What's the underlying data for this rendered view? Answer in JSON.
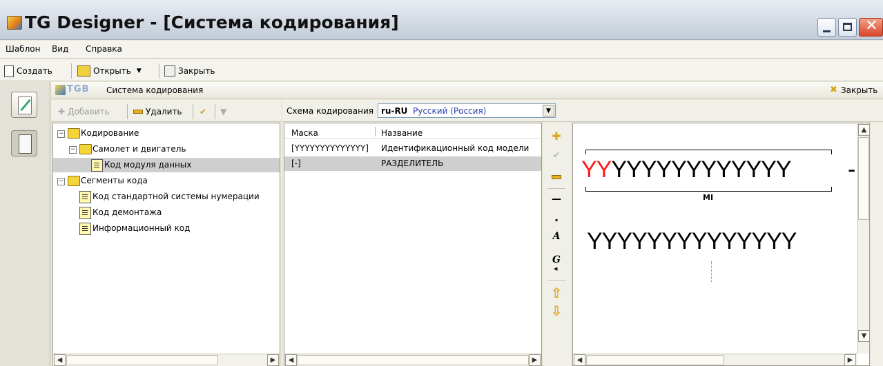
{
  "window": {
    "title": "TG Designer - [Система кодирования]"
  },
  "menu": [
    "Шаблон",
    "Вид",
    "Справка"
  ],
  "toolbar": {
    "create_label": "Создать",
    "open_label": "Открыть",
    "close_label": "Закрыть"
  },
  "panel": {
    "logo_text": "TGB",
    "title": "Система кодирования",
    "close_label": "Закрыть"
  },
  "tree_toolbar": {
    "add_label": "Добавить",
    "delete_label": "Удалить"
  },
  "scheme": {
    "label": "Схема кодирования",
    "code": "ru-RU",
    "name": "Русский (Россия)"
  },
  "tree": [
    {
      "label": "Кодирование",
      "level": 0,
      "type": "folder",
      "expander": "minus"
    },
    {
      "label": "Самолет и двигатель",
      "level": 1,
      "type": "folder",
      "expander": "minus"
    },
    {
      "label": "Код модуля данных",
      "level": 2,
      "type": "doc",
      "selected": true
    },
    {
      "label": "Сегменты кода",
      "level": 0,
      "type": "folder",
      "expander": "minus"
    },
    {
      "label": "Код стандартной системы нумерации",
      "level": 1,
      "type": "doc"
    },
    {
      "label": "Код демонтажа",
      "level": 1,
      "type": "doc"
    },
    {
      "label": "Информационный код",
      "level": 1,
      "type": "doc"
    }
  ],
  "grid": {
    "columns": [
      "Маска",
      "Название"
    ],
    "rows": [
      {
        "mask": "[YYYYYYYYYYYYYY]",
        "name": "Идентификационный код модели"
      },
      {
        "mask": "[-]",
        "name": "РАЗДЕЛИТЕЛЬ"
      }
    ]
  },
  "actions": [
    "add-icon",
    "check-icon",
    "remove-icon",
    "dash-icon",
    "dot-icon",
    "A",
    "G",
    "arrow-up-icon",
    "arrow-down-icon"
  ],
  "preview": {
    "code_red": "YY",
    "code_black": "YYYYYYYYYYYY",
    "separator": "-",
    "segment_label": "MI",
    "code_line2": "YYYYYYYYYYYYYY"
  },
  "colors": {
    "highlight_red": "#ff1a1a",
    "selection": "#cfcfcf"
  }
}
